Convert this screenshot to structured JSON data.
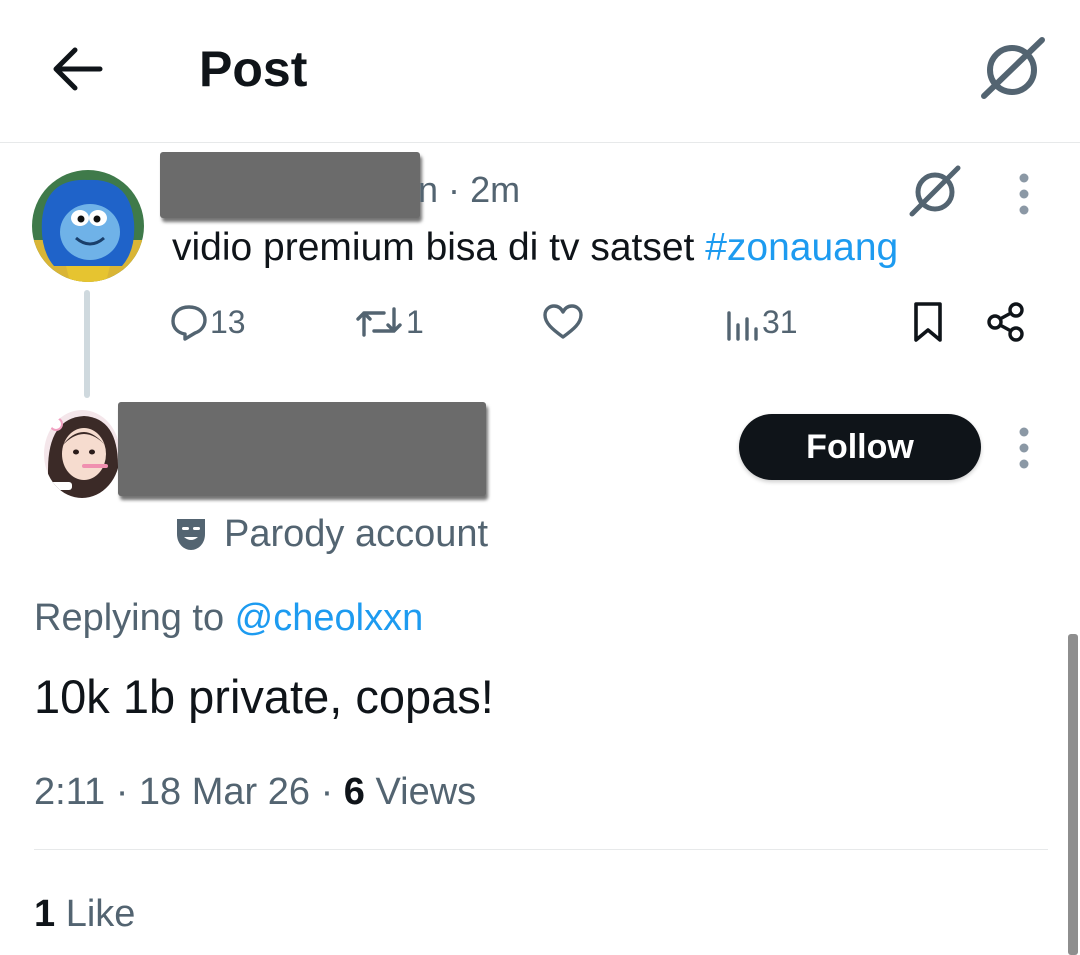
{
  "header": {
    "back_icon": "arrow-left-icon",
    "title": "Post",
    "grok_icon": "grok-icon"
  },
  "parent_post": {
    "author_name_suffix": "n",
    "separator": "·",
    "time": "2m",
    "text": "vidio premium bisa di tv satset ",
    "hashtag": "#zonauang",
    "actions": {
      "reply_count": "13",
      "repost_count": "1",
      "like_count": "",
      "views_count": "31"
    },
    "icons": [
      "reply-icon",
      "repost-icon",
      "like-icon",
      "views-icon",
      "bookmark-icon",
      "share-icon",
      "more-options-icon",
      "grok-icon"
    ]
  },
  "reply_post": {
    "follow_label": "Follow",
    "parody_label": "Parody account",
    "replying_prefix": "Replying to ",
    "replying_handle": "@cheolxxn",
    "text": "10k 1b private, copas!",
    "time": "2:11",
    "sep1": " · ",
    "date": "18 Mar 26",
    "sep2": " · ",
    "views_count": "6",
    "views_label": " Views",
    "likes_count": "1",
    "likes_label": " Like"
  },
  "colors": {
    "text_primary": "#0f1419",
    "text_secondary": "#536471",
    "link": "#1d9bf0",
    "follow_bg": "#0f1419",
    "divider": "#e7e9ea",
    "redaction": "#6b6b6b"
  }
}
